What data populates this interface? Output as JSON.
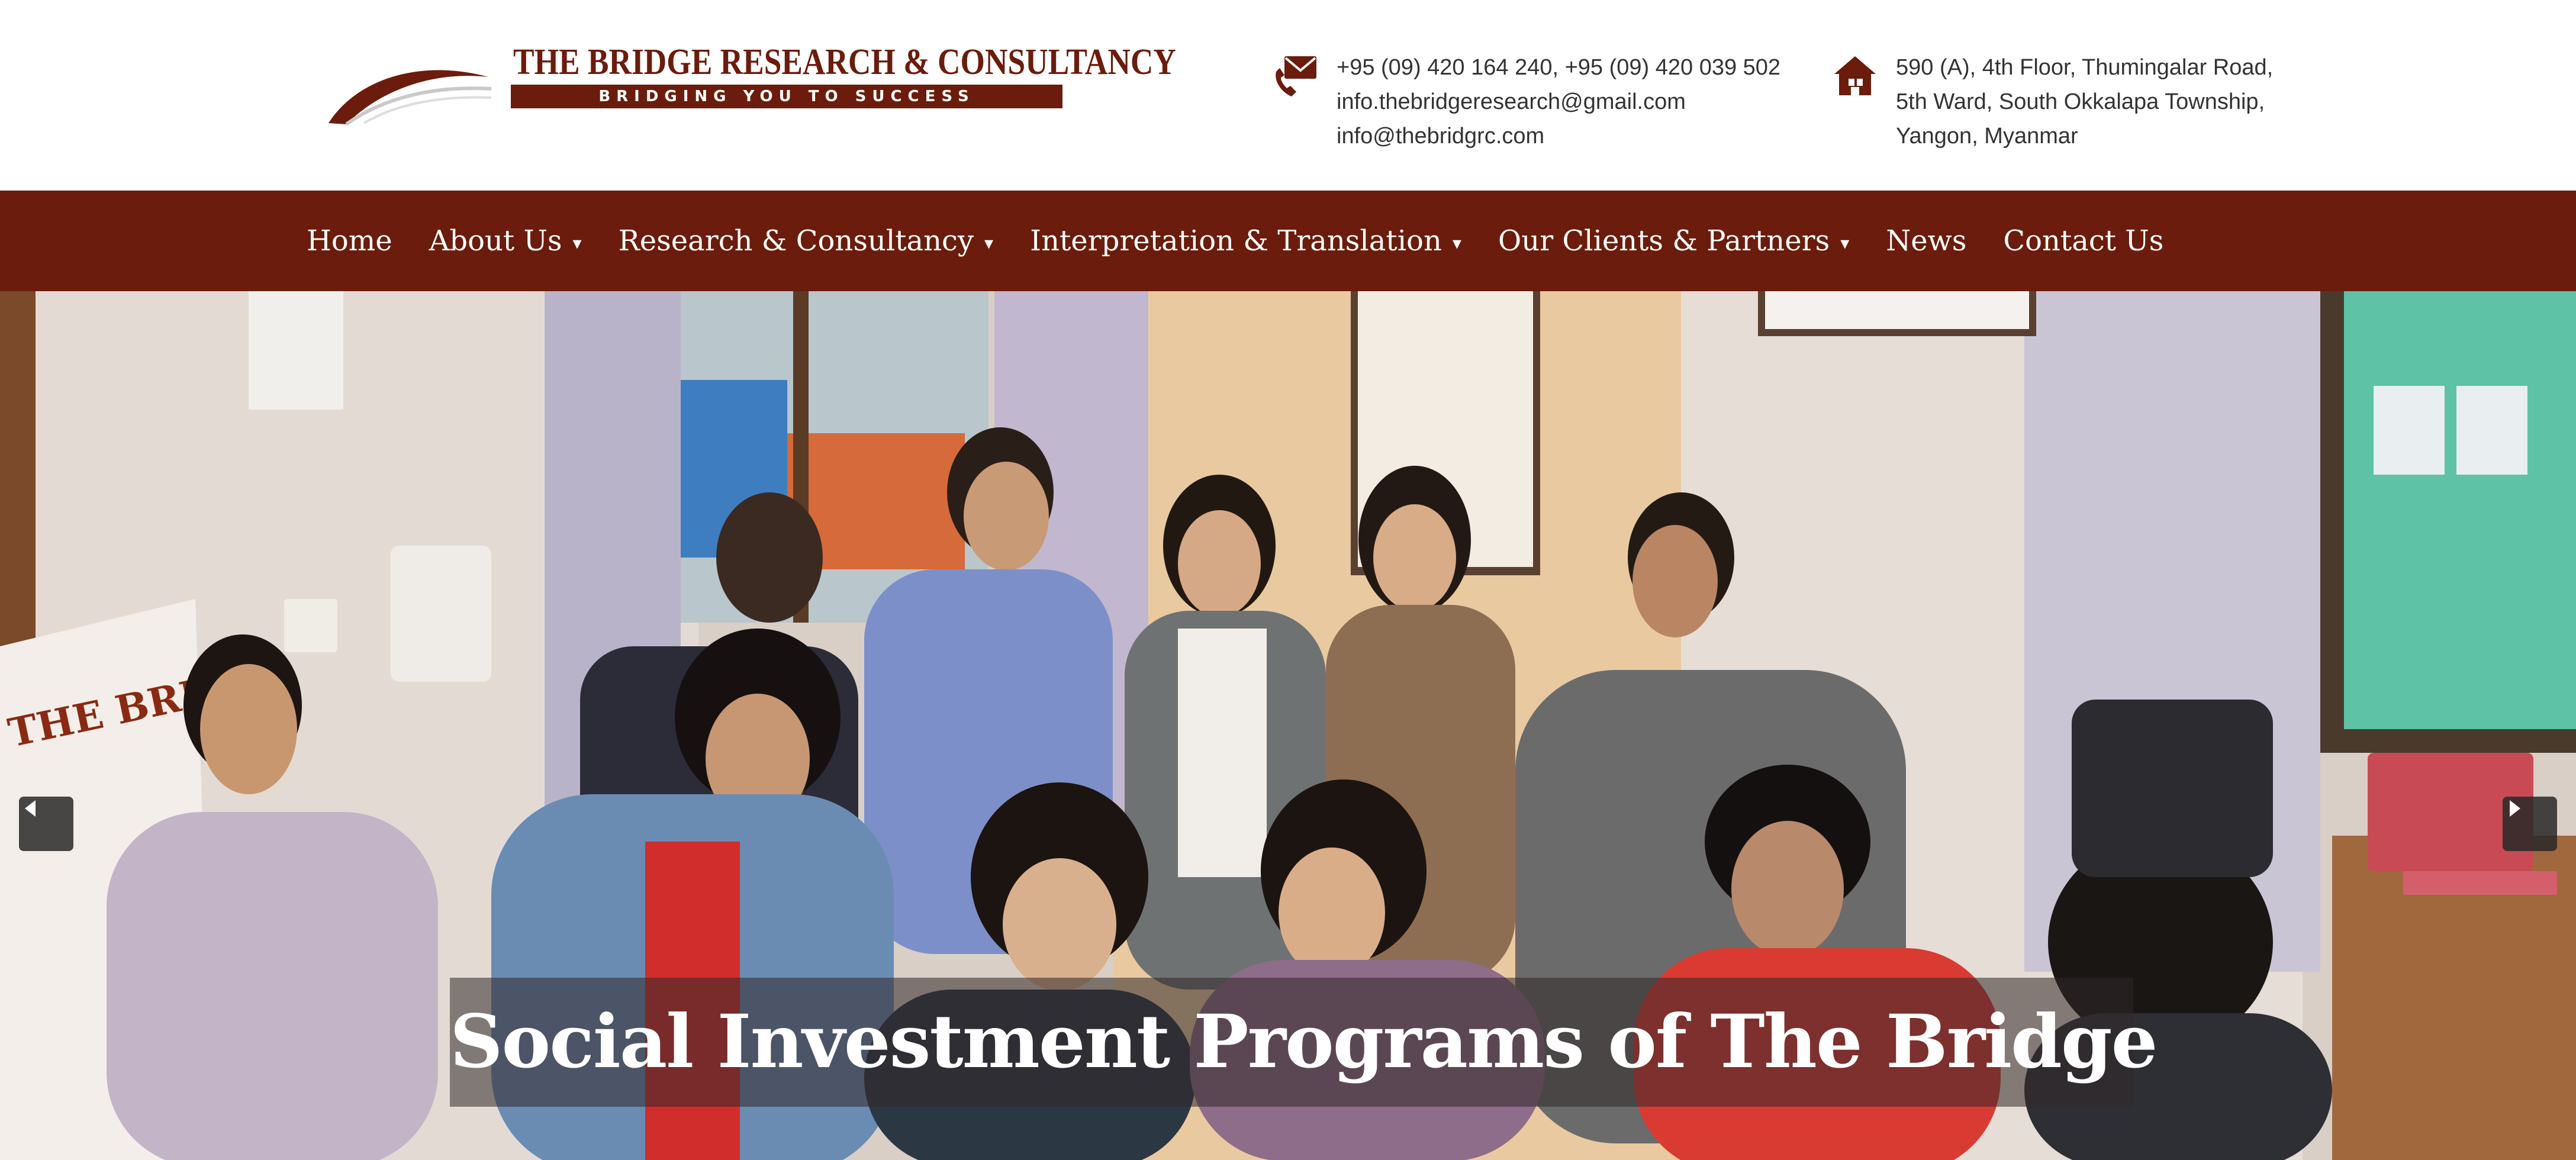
{
  "brand": {
    "name": "THE BRIDGE RESEARCH & CONSULTANCY",
    "tagline": "BRIDGING YOU TO SUCCESS",
    "color": "#6b1c0c"
  },
  "contact": {
    "icon": "envelope-phone-icon",
    "lines": [
      "+95 (09) 420 164 240, +95 (09) 420 039 502",
      "info.thebridgeresearch@gmail.com",
      "info@thebridgrc.com"
    ]
  },
  "address": {
    "icon": "house-icon",
    "lines": [
      "590 (A), 4th Floor, Thumingalar Road,",
      "5th Ward, South Okkalapa Township,",
      "Yangon, Myanmar"
    ]
  },
  "nav": {
    "items": [
      {
        "label": "Home",
        "dropdown": false
      },
      {
        "label": "About Us",
        "dropdown": true
      },
      {
        "label": "Research & Consultancy",
        "dropdown": true
      },
      {
        "label": "Interpretation & Translation",
        "dropdown": true
      },
      {
        "label": "Our Clients & Partners",
        "dropdown": true
      },
      {
        "label": "News",
        "dropdown": false
      },
      {
        "label": "Contact Us",
        "dropdown": false
      }
    ],
    "caret": "▾"
  },
  "hero": {
    "caption": "Social Investment Programs of The Bridge",
    "banner_text": "THE BRIDGE",
    "prev_icon": "chevron-left-icon",
    "next_icon": "chevron-right-icon"
  }
}
